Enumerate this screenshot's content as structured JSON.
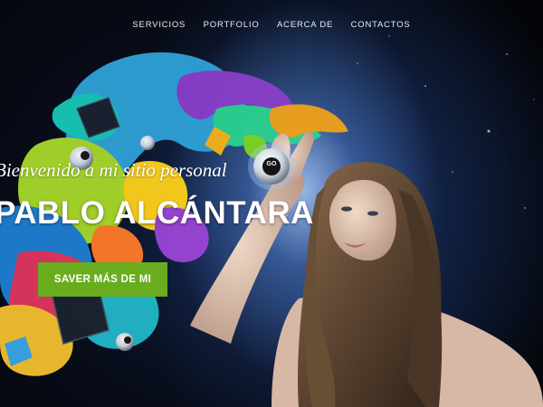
{
  "nav": {
    "items": [
      "SERVICIOS",
      "PORTFOLIO",
      "ACERCA DE",
      "CONTACTOS"
    ]
  },
  "hero": {
    "tagline": "Bienvenido a mi sitio personal",
    "name": "PABLO ALCÁNTARA",
    "cta_label": "SAVER MÁS DE MI",
    "orb_label": "GO"
  },
  "colors": {
    "cta_background": "#69ad1f",
    "background": "#070b16"
  }
}
